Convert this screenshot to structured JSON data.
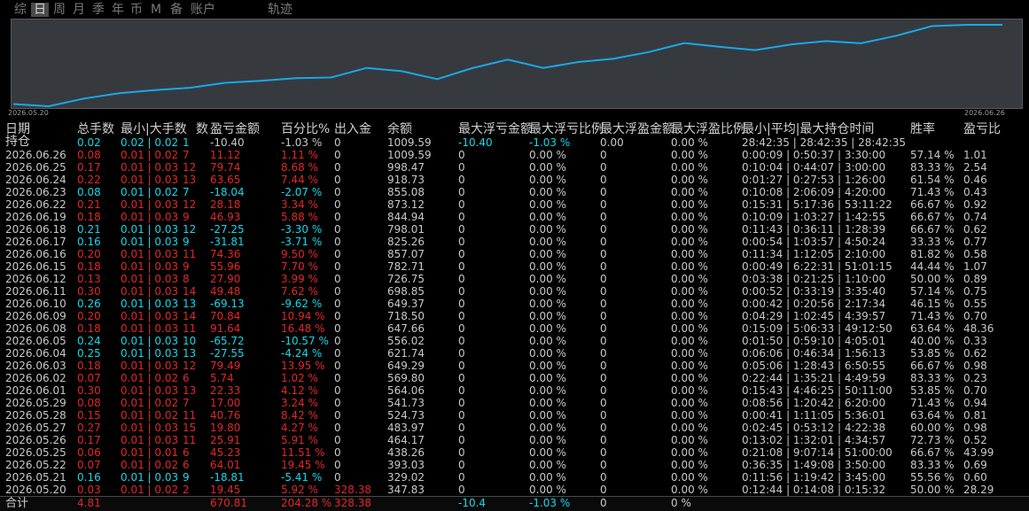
{
  "tabs": [
    {
      "label": "综",
      "active": false
    },
    {
      "label": "日",
      "active": true
    },
    {
      "label": "周",
      "active": false
    },
    {
      "label": "月",
      "active": false
    },
    {
      "label": "季",
      "active": false
    },
    {
      "label": "年",
      "active": false
    },
    {
      "label": "币",
      "active": false
    },
    {
      "label": "M",
      "active": false
    },
    {
      "label": "备",
      "active": false
    },
    {
      "label": "账户",
      "active": false
    },
    {
      "label": "轨迹",
      "active": false
    }
  ],
  "chart": {
    "start_label": "2026.05.20",
    "end_label": "2026.06.26",
    "line_color": "#1aa8e8",
    "series": [
      347.83,
      329.02,
      393.03,
      438.26,
      464.17,
      483.97,
      524.73,
      541.73,
      564.06,
      569.8,
      649.29,
      621.74,
      556.02,
      647.66,
      718.5,
      649.37,
      698.85,
      726.75,
      782.71,
      857.07,
      825.26,
      798.01,
      844.94,
      873.12,
      855.08,
      918.73,
      998.47,
      1009.59,
      1009.59
    ]
  },
  "headers": [
    "日期",
    "总手数",
    "最小|大手数",
    "数",
    "盈亏金额",
    "百分比%",
    "出入金",
    "余额",
    "最大浮亏金额",
    "最大浮亏比例",
    "最大浮盈金额",
    "最大浮盈比例",
    "最小|平均|最大持仓时间",
    "胜率",
    "盈亏比"
  ],
  "position_row": {
    "date": "持仓",
    "lots": "0.02",
    "minmax": "0.02 | 0.02",
    "count": "1",
    "pnl": "-10.40",
    "pct": "-1.03 %",
    "inout": "0",
    "balance": "1009.59",
    "maxloss": "-10.40",
    "maxlosspct": "-1.03 %",
    "maxprofit": "0.00",
    "maxprofitpct": "0.00 %",
    "holdtime": "28:42:35 | 28:42:35 | 28:42:35",
    "winrate": "",
    "pf": ""
  },
  "rows": [
    {
      "date": "2026.06.26",
      "lots": "0.08",
      "minmax": "0.01 | 0.02",
      "count": "7",
      "pnl": "11.12",
      "pct": "1.11 %",
      "inout": "0",
      "balance": "1009.59",
      "maxloss": "0",
      "maxlosspct": "0.00 %",
      "maxprofit": "0",
      "maxprofitpct": "0.00 %",
      "holdtime": "0:00:09 | 0:50:37 | 3:30:00",
      "winrate": "57.14 %",
      "pf": "1.01"
    },
    {
      "date": "2026.06.25",
      "lots": "0.17",
      "minmax": "0.01 | 0.03",
      "count": "12",
      "pnl": "79.74",
      "pct": "8.68 %",
      "inout": "0",
      "balance": "998.47",
      "maxloss": "0",
      "maxlosspct": "0.00 %",
      "maxprofit": "0",
      "maxprofitpct": "0.00 %",
      "holdtime": "0:10:04 | 0:44:07 | 3:00:00",
      "winrate": "83.33 %",
      "pf": "2.54"
    },
    {
      "date": "2026.06.24",
      "lots": "0.22",
      "minmax": "0.01 | 0.03",
      "count": "13",
      "pnl": "63.65",
      "pct": "7.44 %",
      "inout": "0",
      "balance": "918.73",
      "maxloss": "0",
      "maxlosspct": "0.00 %",
      "maxprofit": "0",
      "maxprofitpct": "0.00 %",
      "holdtime": "0:01:27 | 0:27:53 | 1:26:00",
      "winrate": "61.54 %",
      "pf": "0.46"
    },
    {
      "date": "2026.06.23",
      "lots": "0.08",
      "minmax": "0.01 | 0.02",
      "count": "7",
      "pnl": "-18.04",
      "pct": "-2.07 %",
      "inout": "0",
      "balance": "855.08",
      "maxloss": "0",
      "maxlosspct": "0.00 %",
      "maxprofit": "0",
      "maxprofitpct": "0.00 %",
      "holdtime": "0:10:08 | 2:06:09 | 4:20:00",
      "winrate": "71.43 %",
      "pf": "0.43"
    },
    {
      "date": "2026.06.22",
      "lots": "0.21",
      "minmax": "0.01 | 0.03",
      "count": "12",
      "pnl": "28.18",
      "pct": "3.34 %",
      "inout": "0",
      "balance": "873.12",
      "maxloss": "0",
      "maxlosspct": "0.00 %",
      "maxprofit": "0",
      "maxprofitpct": "0.00 %",
      "holdtime": "0:15:31 | 5:17:36 | 53:11:22",
      "winrate": "66.67 %",
      "pf": "0.92"
    },
    {
      "date": "2026.06.19",
      "lots": "0.18",
      "minmax": "0.01 | 0.03",
      "count": "9",
      "pnl": "46.93",
      "pct": "5.88 %",
      "inout": "0",
      "balance": "844.94",
      "maxloss": "0",
      "maxlosspct": "0.00 %",
      "maxprofit": "0",
      "maxprofitpct": "0.00 %",
      "holdtime": "0:10:09 | 1:03:27 | 1:42:55",
      "winrate": "66.67 %",
      "pf": "0.74"
    },
    {
      "date": "2026.06.18",
      "lots": "0.21",
      "minmax": "0.01 | 0.03",
      "count": "12",
      "pnl": "-27.25",
      "pct": "-3.30 %",
      "inout": "0",
      "balance": "798.01",
      "maxloss": "0",
      "maxlosspct": "0.00 %",
      "maxprofit": "0",
      "maxprofitpct": "0.00 %",
      "holdtime": "0:11:43 | 0:36:11 | 1:28:39",
      "winrate": "66.67 %",
      "pf": "0.62"
    },
    {
      "date": "2026.06.17",
      "lots": "0.16",
      "minmax": "0.01 | 0.03",
      "count": "9",
      "pnl": "-31.81",
      "pct": "-3.71 %",
      "inout": "0",
      "balance": "825.26",
      "maxloss": "0",
      "maxlosspct": "0.00 %",
      "maxprofit": "0",
      "maxprofitpct": "0.00 %",
      "holdtime": "0:00:54 | 1:03:57 | 4:50:24",
      "winrate": "33.33 %",
      "pf": "0.77"
    },
    {
      "date": "2026.06.16",
      "lots": "0.20",
      "minmax": "0.01 | 0.03",
      "count": "11",
      "pnl": "74.36",
      "pct": "9.50 %",
      "inout": "0",
      "balance": "857.07",
      "maxloss": "0",
      "maxlosspct": "0.00 %",
      "maxprofit": "0",
      "maxprofitpct": "0.00 %",
      "holdtime": "0:11:34 | 1:12:05 | 2:10:00",
      "winrate": "81.82 %",
      "pf": "0.58"
    },
    {
      "date": "2026.06.15",
      "lots": "0.18",
      "minmax": "0.01 | 0.03",
      "count": "9",
      "pnl": "55.96",
      "pct": "7.70 %",
      "inout": "0",
      "balance": "782.71",
      "maxloss": "0",
      "maxlosspct": "0.00 %",
      "maxprofit": "0",
      "maxprofitpct": "0.00 %",
      "holdtime": "0:00:49 | 6:22:31 | 51:01:15",
      "winrate": "44.44 %",
      "pf": "1.07"
    },
    {
      "date": "2026.06.12",
      "lots": "0.13",
      "minmax": "0.01 | 0.03",
      "count": "8",
      "pnl": "27.90",
      "pct": "3.99 %",
      "inout": "0",
      "balance": "726.75",
      "maxloss": "0",
      "maxlosspct": "0.00 %",
      "maxprofit": "0",
      "maxprofitpct": "0.00 %",
      "holdtime": "0:03:38 | 0:21:25 | 1:10:00",
      "winrate": "50.00 %",
      "pf": "0.89"
    },
    {
      "date": "2026.06.11",
      "lots": "0.30",
      "minmax": "0.01 | 0.03",
      "count": "14",
      "pnl": "49.48",
      "pct": "7.62 %",
      "inout": "0",
      "balance": "698.85",
      "maxloss": "0",
      "maxlosspct": "0.00 %",
      "maxprofit": "0",
      "maxprofitpct": "0.00 %",
      "holdtime": "0:00:52 | 0:33:19 | 3:35:40",
      "winrate": "57.14 %",
      "pf": "0.75"
    },
    {
      "date": "2026.06.10",
      "lots": "0.26",
      "minmax": "0.01 | 0.03",
      "count": "13",
      "pnl": "-69.13",
      "pct": "-9.62 %",
      "inout": "0",
      "balance": "649.37",
      "maxloss": "0",
      "maxlosspct": "0.00 %",
      "maxprofit": "0",
      "maxprofitpct": "0.00 %",
      "holdtime": "0:00:42 | 0:20:56 | 2:17:34",
      "winrate": "46.15 %",
      "pf": "0.55"
    },
    {
      "date": "2026.06.09",
      "lots": "0.20",
      "minmax": "0.01 | 0.03",
      "count": "14",
      "pnl": "70.84",
      "pct": "10.94 %",
      "inout": "0",
      "balance": "718.50",
      "maxloss": "0",
      "maxlosspct": "0.00 %",
      "maxprofit": "0",
      "maxprofitpct": "0.00 %",
      "holdtime": "0:04:29 | 1:02:45 | 4:39:57",
      "winrate": "71.43 %",
      "pf": "0.70"
    },
    {
      "date": "2026.06.08",
      "lots": "0.18",
      "minmax": "0.01 | 0.03",
      "count": "11",
      "pnl": "91.64",
      "pct": "16.48 %",
      "inout": "0",
      "balance": "647.66",
      "maxloss": "0",
      "maxlosspct": "0.00 %",
      "maxprofit": "0",
      "maxprofitpct": "0.00 %",
      "holdtime": "0:15:09 | 5:06:33 | 49:12:50",
      "winrate": "63.64 %",
      "pf": "48.36"
    },
    {
      "date": "2026.06.05",
      "lots": "0.24",
      "minmax": "0.01 | 0.03",
      "count": "10",
      "pnl": "-65.72",
      "pct": "-10.57 %",
      "inout": "0",
      "balance": "556.02",
      "maxloss": "0",
      "maxlosspct": "0.00 %",
      "maxprofit": "0",
      "maxprofitpct": "0.00 %",
      "holdtime": "0:01:50 | 0:59:10 | 4:05:01",
      "winrate": "40.00 %",
      "pf": "0.33"
    },
    {
      "date": "2026.06.04",
      "lots": "0.25",
      "minmax": "0.01 | 0.03",
      "count": "13",
      "pnl": "-27.55",
      "pct": "-4.24 %",
      "inout": "0",
      "balance": "621.74",
      "maxloss": "0",
      "maxlosspct": "0.00 %",
      "maxprofit": "0",
      "maxprofitpct": "0.00 %",
      "holdtime": "0:06:06 | 0:46:34 | 1:56:13",
      "winrate": "53.85 %",
      "pf": "0.62"
    },
    {
      "date": "2026.06.03",
      "lots": "0.18",
      "minmax": "0.01 | 0.03",
      "count": "12",
      "pnl": "79.49",
      "pct": "13.95 %",
      "inout": "0",
      "balance": "649.29",
      "maxloss": "0",
      "maxlosspct": "0.00 %",
      "maxprofit": "0",
      "maxprofitpct": "0.00 %",
      "holdtime": "0:05:06 | 1:28:43 | 6:50:55",
      "winrate": "66.67 %",
      "pf": "0.98"
    },
    {
      "date": "2026.06.02",
      "lots": "0.07",
      "minmax": "0.01 | 0.02",
      "count": "6",
      "pnl": "5.74",
      "pct": "1.02 %",
      "inout": "0",
      "balance": "569.80",
      "maxloss": "0",
      "maxlosspct": "0.00 %",
      "maxprofit": "0",
      "maxprofitpct": "0.00 %",
      "holdtime": "0:22:44 | 1:35:21 | 4:49:59",
      "winrate": "83.33 %",
      "pf": "0.23"
    },
    {
      "date": "2026.06.01",
      "lots": "0.30",
      "minmax": "0.01 | 0.03",
      "count": "13",
      "pnl": "22.33",
      "pct": "4.12 %",
      "inout": "0",
      "balance": "564.06",
      "maxloss": "0",
      "maxlosspct": "0.00 %",
      "maxprofit": "0",
      "maxprofitpct": "0.00 %",
      "holdtime": "0:15:43 | 4:46:25 | 50:11:00",
      "winrate": "53.85 %",
      "pf": "0.70"
    },
    {
      "date": "2026.05.29",
      "lots": "0.08",
      "minmax": "0.01 | 0.02",
      "count": "7",
      "pnl": "17.00",
      "pct": "3.24 %",
      "inout": "0",
      "balance": "541.73",
      "maxloss": "0",
      "maxlosspct": "0.00 %",
      "maxprofit": "0",
      "maxprofitpct": "0.00 %",
      "holdtime": "0:08:56 | 1:20:42 | 6:20:00",
      "winrate": "71.43 %",
      "pf": "0.94"
    },
    {
      "date": "2026.05.28",
      "lots": "0.15",
      "minmax": "0.01 | 0.02",
      "count": "11",
      "pnl": "40.76",
      "pct": "8.42 %",
      "inout": "0",
      "balance": "524.73",
      "maxloss": "0",
      "maxlosspct": "0.00 %",
      "maxprofit": "0",
      "maxprofitpct": "0.00 %",
      "holdtime": "0:00:41 | 1:11:05 | 5:36:01",
      "winrate": "63.64 %",
      "pf": "0.81"
    },
    {
      "date": "2026.05.27",
      "lots": "0.27",
      "minmax": "0.01 | 0.03",
      "count": "15",
      "pnl": "19.80",
      "pct": "4.27 %",
      "inout": "0",
      "balance": "483.97",
      "maxloss": "0",
      "maxlosspct": "0.00 %",
      "maxprofit": "0",
      "maxprofitpct": "0.00 %",
      "holdtime": "0:02:45 | 0:53:12 | 4:22:38",
      "winrate": "60.00 %",
      "pf": "0.98"
    },
    {
      "date": "2026.05.26",
      "lots": "0.17",
      "minmax": "0.01 | 0.03",
      "count": "11",
      "pnl": "25.91",
      "pct": "5.91 %",
      "inout": "0",
      "balance": "464.17",
      "maxloss": "0",
      "maxlosspct": "0.00 %",
      "maxprofit": "0",
      "maxprofitpct": "0.00 %",
      "holdtime": "0:13:02 | 1:32:01 | 4:34:57",
      "winrate": "72.73 %",
      "pf": "0.52"
    },
    {
      "date": "2026.05.25",
      "lots": "0.06",
      "minmax": "0.01 | 0.01",
      "count": "6",
      "pnl": "45.23",
      "pct": "11.51 %",
      "inout": "0",
      "balance": "438.26",
      "maxloss": "0",
      "maxlosspct": "0.00 %",
      "maxprofit": "0",
      "maxprofitpct": "0.00 %",
      "holdtime": "0:21:08 | 9:07:14 | 51:00:00",
      "winrate": "66.67 %",
      "pf": "43.99"
    },
    {
      "date": "2026.05.22",
      "lots": "0.07",
      "minmax": "0.01 | 0.02",
      "count": "6",
      "pnl": "64.01",
      "pct": "19.45 %",
      "inout": "0",
      "balance": "393.03",
      "maxloss": "0",
      "maxlosspct": "0.00 %",
      "maxprofit": "0",
      "maxprofitpct": "0.00 %",
      "holdtime": "0:36:35 | 1:49:08 | 3:50:00",
      "winrate": "83.33 %",
      "pf": "0.69"
    },
    {
      "date": "2026.05.21",
      "lots": "0.16",
      "minmax": "0.01 | 0.03",
      "count": "9",
      "pnl": "-18.81",
      "pct": "-5.41 %",
      "inout": "0",
      "balance": "329.02",
      "maxloss": "0",
      "maxlosspct": "0.00 %",
      "maxprofit": "0",
      "maxprofitpct": "0.00 %",
      "holdtime": "0:11:56 | 1:19:42 | 3:45:00",
      "winrate": "55.56 %",
      "pf": "0.60"
    },
    {
      "date": "2026.05.20",
      "lots": "0.03",
      "minmax": "0.01 | 0.02",
      "count": "2",
      "pnl": "19.45",
      "pct": "5.92 %",
      "inout": "328.38",
      "balance": "347.83",
      "maxloss": "0",
      "maxlosspct": "0.00 %",
      "maxprofit": "0",
      "maxprofitpct": "0.00 %",
      "holdtime": "0:12:44 | 0:14:08 | 0:15:32",
      "winrate": "50.00 %",
      "pf": "28.29"
    }
  ],
  "totals": {
    "label": "合计",
    "lots": "4.81",
    "pnl": "670.81",
    "pct": "204.28 %",
    "inout": "328.38",
    "maxloss": "-10.4",
    "maxlosspct": "-1.03 %",
    "maxprofit": "0",
    "maxprofitpct": "0 %"
  },
  "colors": {
    "positive": "#e02828",
    "negative": "#16d8e8",
    "neutral": "#c8c8c8",
    "background": "#000000",
    "chart_bg": "#363a3f"
  }
}
